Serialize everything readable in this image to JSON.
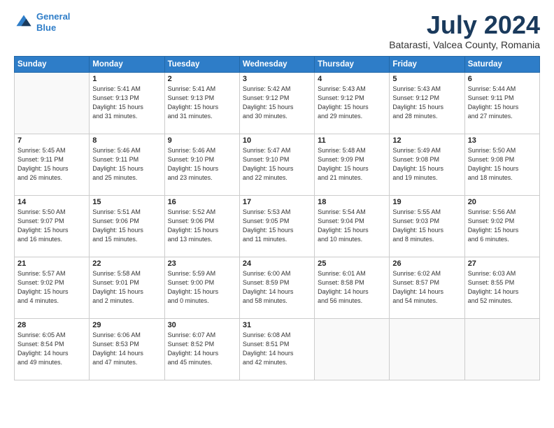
{
  "header": {
    "logo_line1": "General",
    "logo_line2": "Blue",
    "month": "July 2024",
    "location": "Batarasti, Valcea County, Romania"
  },
  "days_of_week": [
    "Sunday",
    "Monday",
    "Tuesday",
    "Wednesday",
    "Thursday",
    "Friday",
    "Saturday"
  ],
  "weeks": [
    [
      {
        "day": "",
        "info": ""
      },
      {
        "day": "1",
        "info": "Sunrise: 5:41 AM\nSunset: 9:13 PM\nDaylight: 15 hours\nand 31 minutes."
      },
      {
        "day": "2",
        "info": "Sunrise: 5:41 AM\nSunset: 9:13 PM\nDaylight: 15 hours\nand 31 minutes."
      },
      {
        "day": "3",
        "info": "Sunrise: 5:42 AM\nSunset: 9:12 PM\nDaylight: 15 hours\nand 30 minutes."
      },
      {
        "day": "4",
        "info": "Sunrise: 5:43 AM\nSunset: 9:12 PM\nDaylight: 15 hours\nand 29 minutes."
      },
      {
        "day": "5",
        "info": "Sunrise: 5:43 AM\nSunset: 9:12 PM\nDaylight: 15 hours\nand 28 minutes."
      },
      {
        "day": "6",
        "info": "Sunrise: 5:44 AM\nSunset: 9:11 PM\nDaylight: 15 hours\nand 27 minutes."
      }
    ],
    [
      {
        "day": "7",
        "info": "Sunrise: 5:45 AM\nSunset: 9:11 PM\nDaylight: 15 hours\nand 26 minutes."
      },
      {
        "day": "8",
        "info": "Sunrise: 5:46 AM\nSunset: 9:11 PM\nDaylight: 15 hours\nand 25 minutes."
      },
      {
        "day": "9",
        "info": "Sunrise: 5:46 AM\nSunset: 9:10 PM\nDaylight: 15 hours\nand 23 minutes."
      },
      {
        "day": "10",
        "info": "Sunrise: 5:47 AM\nSunset: 9:10 PM\nDaylight: 15 hours\nand 22 minutes."
      },
      {
        "day": "11",
        "info": "Sunrise: 5:48 AM\nSunset: 9:09 PM\nDaylight: 15 hours\nand 21 minutes."
      },
      {
        "day": "12",
        "info": "Sunrise: 5:49 AM\nSunset: 9:08 PM\nDaylight: 15 hours\nand 19 minutes."
      },
      {
        "day": "13",
        "info": "Sunrise: 5:50 AM\nSunset: 9:08 PM\nDaylight: 15 hours\nand 18 minutes."
      }
    ],
    [
      {
        "day": "14",
        "info": "Sunrise: 5:50 AM\nSunset: 9:07 PM\nDaylight: 15 hours\nand 16 minutes."
      },
      {
        "day": "15",
        "info": "Sunrise: 5:51 AM\nSunset: 9:06 PM\nDaylight: 15 hours\nand 15 minutes."
      },
      {
        "day": "16",
        "info": "Sunrise: 5:52 AM\nSunset: 9:06 PM\nDaylight: 15 hours\nand 13 minutes."
      },
      {
        "day": "17",
        "info": "Sunrise: 5:53 AM\nSunset: 9:05 PM\nDaylight: 15 hours\nand 11 minutes."
      },
      {
        "day": "18",
        "info": "Sunrise: 5:54 AM\nSunset: 9:04 PM\nDaylight: 15 hours\nand 10 minutes."
      },
      {
        "day": "19",
        "info": "Sunrise: 5:55 AM\nSunset: 9:03 PM\nDaylight: 15 hours\nand 8 minutes."
      },
      {
        "day": "20",
        "info": "Sunrise: 5:56 AM\nSunset: 9:02 PM\nDaylight: 15 hours\nand 6 minutes."
      }
    ],
    [
      {
        "day": "21",
        "info": "Sunrise: 5:57 AM\nSunset: 9:02 PM\nDaylight: 15 hours\nand 4 minutes."
      },
      {
        "day": "22",
        "info": "Sunrise: 5:58 AM\nSunset: 9:01 PM\nDaylight: 15 hours\nand 2 minutes."
      },
      {
        "day": "23",
        "info": "Sunrise: 5:59 AM\nSunset: 9:00 PM\nDaylight: 15 hours\nand 0 minutes."
      },
      {
        "day": "24",
        "info": "Sunrise: 6:00 AM\nSunset: 8:59 PM\nDaylight: 14 hours\nand 58 minutes."
      },
      {
        "day": "25",
        "info": "Sunrise: 6:01 AM\nSunset: 8:58 PM\nDaylight: 14 hours\nand 56 minutes."
      },
      {
        "day": "26",
        "info": "Sunrise: 6:02 AM\nSunset: 8:57 PM\nDaylight: 14 hours\nand 54 minutes."
      },
      {
        "day": "27",
        "info": "Sunrise: 6:03 AM\nSunset: 8:55 PM\nDaylight: 14 hours\nand 52 minutes."
      }
    ],
    [
      {
        "day": "28",
        "info": "Sunrise: 6:05 AM\nSunset: 8:54 PM\nDaylight: 14 hours\nand 49 minutes."
      },
      {
        "day": "29",
        "info": "Sunrise: 6:06 AM\nSunset: 8:53 PM\nDaylight: 14 hours\nand 47 minutes."
      },
      {
        "day": "30",
        "info": "Sunrise: 6:07 AM\nSunset: 8:52 PM\nDaylight: 14 hours\nand 45 minutes."
      },
      {
        "day": "31",
        "info": "Sunrise: 6:08 AM\nSunset: 8:51 PM\nDaylight: 14 hours\nand 42 minutes."
      },
      {
        "day": "",
        "info": ""
      },
      {
        "day": "",
        "info": ""
      },
      {
        "day": "",
        "info": ""
      }
    ]
  ]
}
